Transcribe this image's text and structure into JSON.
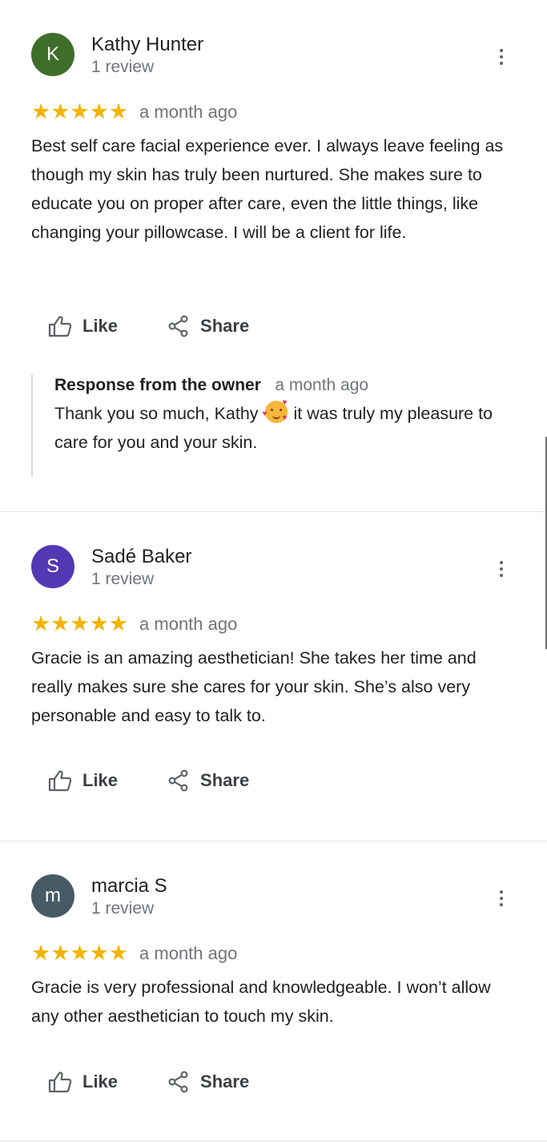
{
  "actions": {
    "like_label": "Like",
    "share_label": "Share"
  },
  "reviews": [
    {
      "initial": "K",
      "avatar_color": "#3f6e2a",
      "name": "Kathy Hunter",
      "review_count": "1 review",
      "rating": 5,
      "stars": "★★★★★",
      "date": "a month ago",
      "text": "Best self care facial experience ever. I always leave feeling as though my skin has truly been nurtured. She makes sure to educate you on proper after care, even the little things, like changing your pillowcase. I will be a client for life.",
      "owner_response": {
        "title": "Response from the owner",
        "date": "a month ago",
        "text_before_emoji": "Thank you so much, Kathy",
        "emoji": "smiling-face-with-hearts",
        "text_after_emoji": "it was truly my pleasure to care for you and your skin."
      }
    },
    {
      "initial": "S",
      "avatar_color": "#5239b3",
      "name": "Sadé Baker",
      "review_count": "1 review",
      "rating": 5,
      "stars": "★★★★★",
      "date": "a month ago",
      "text": "Gracie is an amazing aesthetician! She takes her time and really makes sure she cares for your skin. She’s also very personable and easy to talk to."
    },
    {
      "initial": "m",
      "avatar_color": "#455a64",
      "name": "marcia S",
      "review_count": "1 review",
      "rating": 5,
      "stars": "★★★★★",
      "date": "a month ago",
      "text": "Gracie is very professional and knowledgeable. I won’t allow any other aesthetician to touch my skin."
    }
  ]
}
